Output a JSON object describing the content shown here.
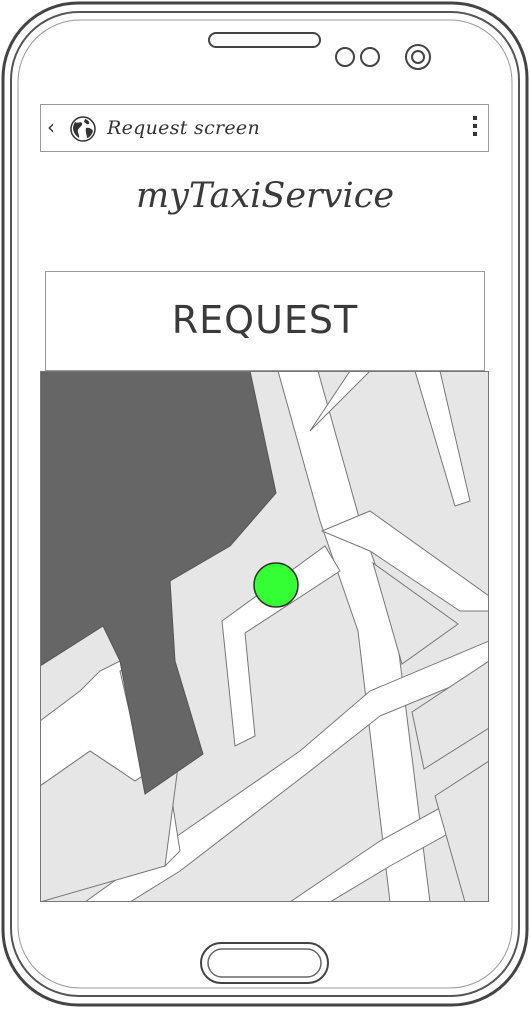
{
  "titlebar": {
    "back_icon": "chevron-left-icon",
    "globe_icon": "globe-icon",
    "title": "Request screen",
    "menu_icon": "kebab-menu-icon"
  },
  "app": {
    "name": "myTaxiService"
  },
  "request": {
    "label": "REQUEST"
  },
  "map": {
    "marker_color": "#33ff33",
    "block_color": "#666666",
    "ground_color": "#e6e6e6",
    "road_color": "#ffffff"
  }
}
